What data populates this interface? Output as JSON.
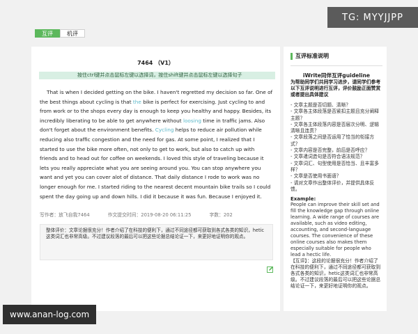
{
  "watermarks": {
    "top": "TG: MYYJJPP",
    "bottom": "www.anan-log.com"
  },
  "tabs": [
    {
      "label": "互评",
      "active": true
    },
    {
      "label": "机评",
      "active": false
    }
  ],
  "essay": {
    "title": "7464 （V1）",
    "instruction": "按住ctrl键并点击鼠标左键以选择词，按住shift键并点击鼠标左键以选择句子",
    "p1": "That is when I decided getting on the bike.  I haven't regretted my decision so far.  One of the best things about cycling is that ",
    "w1": "the",
    "p2": " bike is perfect for exercising.  Just cycling to and from work or to the shops every day is enough to keep you healthy and happy.  Besides, its incredibly liberating to be able to get anywhere without ",
    "w2": "loosing",
    "p3": " time in traffic jams.  Also don't forget about the environment benefits.  ",
    "w3": "Cycling",
    "p4": " helps to reduce air pollution while reducing also traffic congestion and the need for gas.  At some point, I realized that I started to use the bike more often, not only to get to work, but also to catch up with friends and to head out for coffee on weekends.  I loved this style of traveling because it lets you really appreciate what you are seeing around you.  You can stop anywhere you want and yet you can cover alot of distance.  That daily distance I rode to work was no longer enough for me.  I started riding to the nearest decent mountain bike trails so I could spent the day going up and down hills.  I did it because it was fun.  Because I enjoyed it.",
    "author": "写作者：放飞自我7464",
    "submit_time": "作文提交时间：2019-08-20 06:11:25",
    "word_count": "字数：202",
    "review": "整体评价：文章论据很充分！作者介绍了在科技的便利下，通过不同途径都可获取到各式各类的知识，hetic这类词汇也非常高级。不过建议段落的最后可以把这些论据总结论证一下，来更好地证明你的观点。"
  },
  "guide": {
    "header": "互评标准说明",
    "title": "iWrite同伴互评guideline",
    "intro": "为帮助同学们共同学习进步，请同学们参考以下互评说明进行互评，评价鼓励正面赞赏或者提出具体建议",
    "items": [
      "- 文章主题是否切题、清晰？",
      "- 文章各主体段落是否紧扣主题且充分阐释主题？",
      "- 文章各主体段落内容是否层次分明、逻辑清晰且连贯？",
      "- 文章段落之间是否运用了恰当的衔接方式？",
      "- 文章内容是否完整，前后是否呼应？",
      "- 文章遣词造句是否符合语法规范？",
      "- 文章词汇、句型使用是否恰当、且丰富多样？",
      "- 文章是否使用书面语？",
      "- 请对文章作出整体评价，并提供具体反馈。"
    ],
    "example_label": "Example:",
    "example_text": "People can improve their skill set and fill the knowledge gap through online learning. A wide range of courses are available, such as video editing, accounting, and second-language courses. The convenience of these online courses also makes them especially suitable for people who lead a hectic life.",
    "example_comment": "【互评】：这段的论据很充分！作者介绍了在科技的便利下，通过不同途径都可获取到各式各类的知识，hetic这类词汇也非常高级。不过建议段落的最后可以把这些论据总结论证一下，来更好地证明你的观点。"
  }
}
